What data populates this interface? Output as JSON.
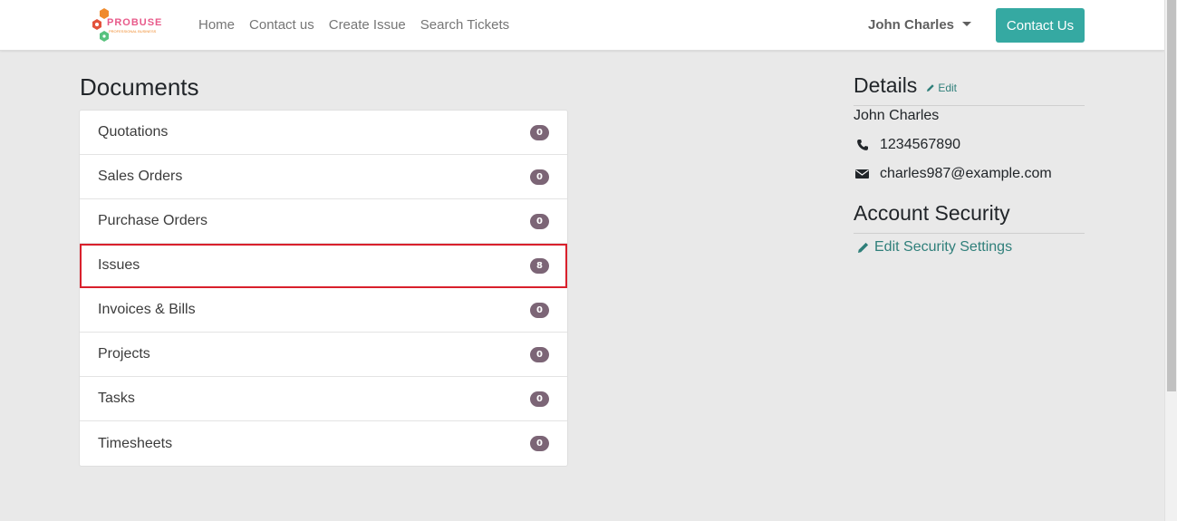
{
  "brand": {
    "name": "PROBUSE",
    "tagline": "PROFESSIONAL BUSINESS",
    "colors": {
      "orange": "#f08a2c",
      "pink": "#e85a8a",
      "green": "#58c27d",
      "red": "#e3533c"
    }
  },
  "navbar": {
    "links": [
      "Home",
      "Contact us",
      "Create Issue",
      "Search Tickets"
    ],
    "user_name": "John Charles",
    "contact_button": "Contact Us",
    "accent_color": "#35a9a2"
  },
  "documents": {
    "title": "Documents",
    "items": [
      {
        "label": "Quotations",
        "count": "0"
      },
      {
        "label": "Sales Orders",
        "count": "0"
      },
      {
        "label": "Purchase Orders",
        "count": "0"
      },
      {
        "label": "Issues",
        "count": "8"
      },
      {
        "label": "Invoices & Bills",
        "count": "0"
      },
      {
        "label": "Projects",
        "count": "0"
      },
      {
        "label": "Tasks",
        "count": "0"
      },
      {
        "label": "Timesheets",
        "count": "0"
      }
    ],
    "highlighted_item": "Issues",
    "badge_color": "#7c6576",
    "highlight_color": "#d9202c"
  },
  "details": {
    "title": "Details",
    "edit_label": "Edit",
    "name": "John Charles",
    "phone": "1234567890",
    "phone_icon": "phone-icon",
    "email": "charles987@example.com",
    "email_icon": "envelope-icon"
  },
  "account_security": {
    "title": "Account Security",
    "edit_link": "Edit Security Settings",
    "link_icon": "pencil-icon"
  }
}
